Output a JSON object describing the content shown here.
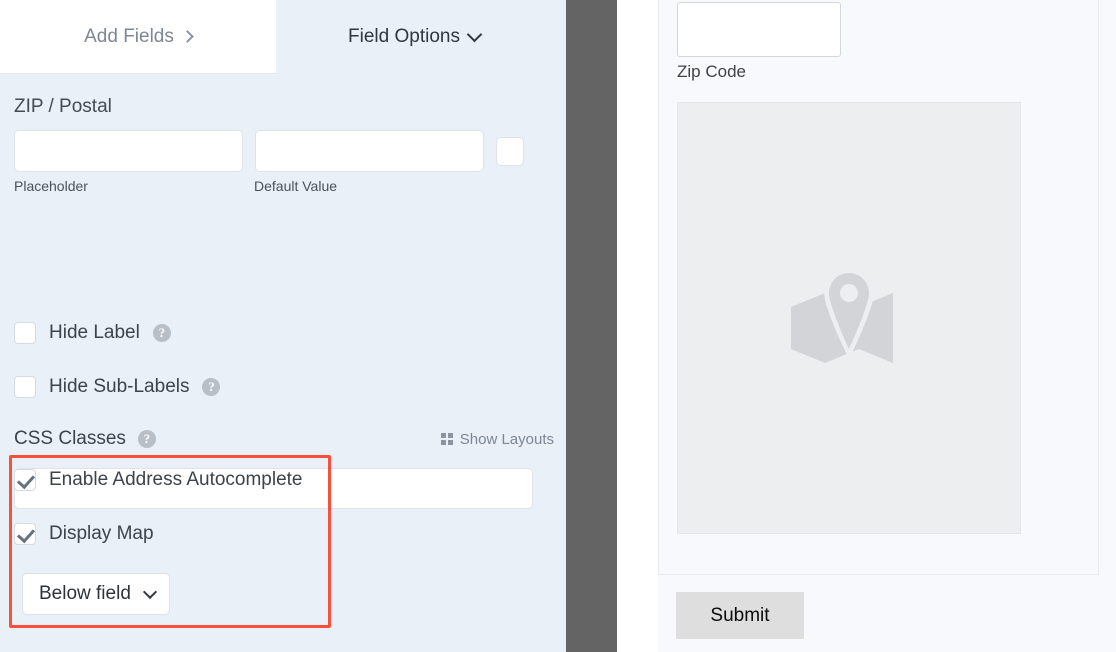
{
  "builder": {
    "tabs": [
      {
        "label": "Add Fields",
        "icon": "chevron-right-icon",
        "active": false
      },
      {
        "label": "Field Options",
        "icon": "chevron-down-icon",
        "active": true
      }
    ],
    "field": {
      "title": "ZIP / Postal",
      "inputs": [
        {
          "name": "placeholder",
          "value": "",
          "sub_label": "Placeholder"
        },
        {
          "name": "default-value",
          "value": "",
          "sub_label": "Default Value"
        },
        {
          "name": "extra-small-field",
          "value": ""
        }
      ],
      "checkboxes": [
        {
          "label": "Hide Label",
          "checked": false,
          "help": "?"
        },
        {
          "label": "Hide Sub-Labels",
          "checked": false,
          "help": "?"
        }
      ],
      "css_classes": {
        "label": "CSS Classes",
        "help": "?",
        "value": "",
        "show_layouts_label": "Show Layouts",
        "show_layouts_icon": "grid-icon"
      },
      "address_options": {
        "autocomplete_label": "Enable Address Autocomplete",
        "autocomplete_checked": true,
        "display_map_label": "Display Map",
        "display_map_checked": true,
        "map_position_value": "Below field",
        "highlight_color": "#f9503c"
      }
    }
  },
  "preview": {
    "zip_field": {
      "value": "",
      "label": "Zip Code"
    },
    "map_placeholder_icon": "map-pin-icon",
    "submit_label": "Submit"
  },
  "colors": {
    "panel_bg": "#e9f0f8",
    "tab_active_bg": "#e9f0f8",
    "tab_inactive_bg": "#ffffff",
    "divider": "#646464",
    "preview_bg": "#f7f9fc",
    "highlight": "#f9503c",
    "submit_bg": "#dedede"
  }
}
